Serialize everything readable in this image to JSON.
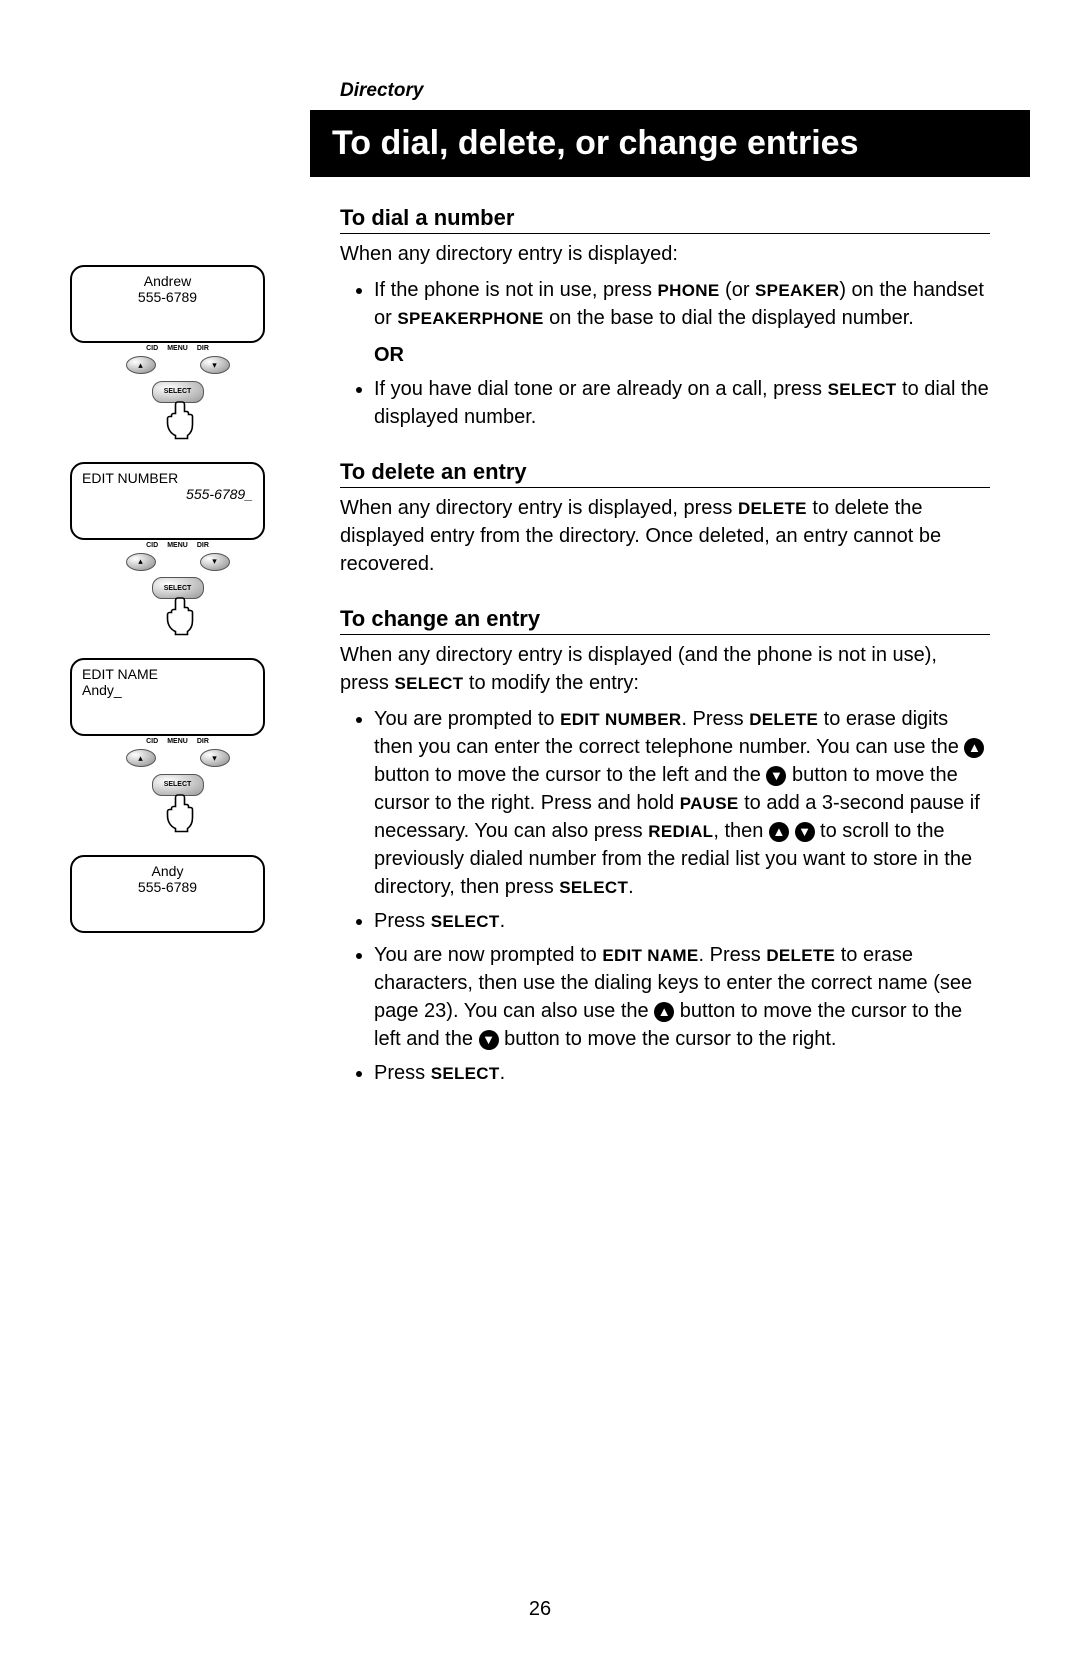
{
  "header": "Directory",
  "title": "To dial, delete, or change entries",
  "pageNumber": "26",
  "screen_labels": {
    "cid": "CID",
    "menu": "MENU",
    "dir": "DIR",
    "select": "SELECT"
  },
  "screens": [
    {
      "line1": "Andrew",
      "line2": "555-6789",
      "align": "center",
      "buttons": true
    },
    {
      "line1": "EDIT NUMBER",
      "line2": "555-6789_",
      "align": "left-right",
      "buttons": true
    },
    {
      "line1": "EDIT NAME",
      "line2": "Andy_",
      "align": "left",
      "buttons": true
    },
    {
      "line1": "Andy",
      "line2": "555-6789",
      "align": "center",
      "buttons": false
    }
  ],
  "sections": {
    "dial": {
      "title": "To dial a number",
      "intro": "When any directory entry is displayed:",
      "bullets": [
        {
          "html": "If the phone is not in use, press <b>PHONE</b> (or <b>SPEAKER</b>) on the handset or <b>SPEAKERPHONE</b> on the base to dial the displayed number."
        }
      ],
      "or": "OR",
      "bullets2": [
        {
          "html": "If you have dial tone or are already on a call, press <b>SELECT</b> to dial the displayed number."
        }
      ]
    },
    "delete": {
      "title": "To delete an entry",
      "html": "When any directory entry is displayed, press <b>DELETE</b> to delete the displayed entry from the directory. Once deleted, an entry cannot be recovered."
    },
    "change": {
      "title": "To change an entry",
      "intro_html": "When any directory entry is displayed (and the phone is not in use), press <b>SELECT</b> to modify the entry:",
      "bullets": [
        {
          "html": "You are prompted to <b>EDIT NUMBER</b>.  Press <b>DELETE</b> to erase digits then you can enter the correct telephone number. You can use the <span class='round-icon'>▲</span> button to move the cursor to the left and the <span class='round-icon'>▼</span> button to move the cursor to the right.  Press and hold <b>PAUSE</b> to add a 3-second pause if necessary. You can also press <b>REDIAL</b>, then <span class='round-icon'>▲</span> <span class='round-icon'>▼</span>  to scroll to the previously dialed number from the redial list you want to store in the directory, then press <b>SELECT</b>."
        },
        {
          "html": "Press <b>SELECT</b>."
        },
        {
          "html": "You are now prompted to <b>EDIT NAME</b>. Press <b>DELETE</b> to erase characters, then use the dialing keys to enter the correct name (see page 23). You can also use the <span class='round-icon'>▲</span> button to move the cursor to the left and the <span class='round-icon'>▼</span> button to move the cursor to the right."
        },
        {
          "html": "Press <b>SELECT</b>."
        }
      ]
    }
  }
}
